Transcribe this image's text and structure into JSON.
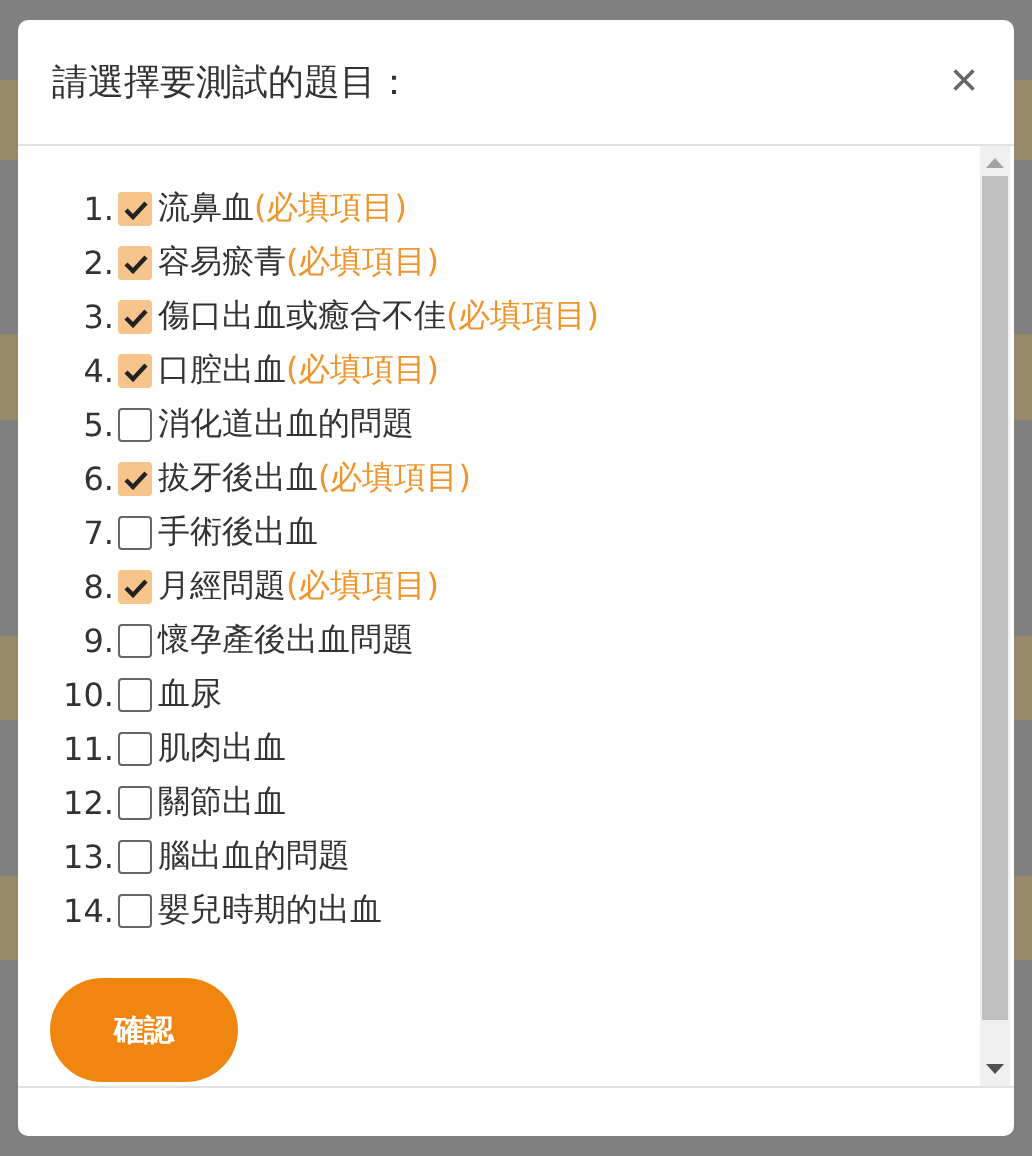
{
  "dialog": {
    "title": "請選擇要測試的題目：",
    "close": "×",
    "items": [
      {
        "number": "1.",
        "label": "流鼻血",
        "required_note": "(必填項目)",
        "checked": true
      },
      {
        "number": "2.",
        "label": "容易瘀青",
        "required_note": "(必填項目)",
        "checked": true
      },
      {
        "number": "3.",
        "label": "傷口出血或癒合不佳",
        "required_note": "(必填項目)",
        "checked": true
      },
      {
        "number": "4.",
        "label": "口腔出血",
        "required_note": "(必填項目)",
        "checked": true
      },
      {
        "number": "5.",
        "label": "消化道出血的問題",
        "checked": false
      },
      {
        "number": "6.",
        "label": "拔牙後出血",
        "required_note": "(必填項目)",
        "checked": true
      },
      {
        "number": "7.",
        "label": "手術後出血",
        "checked": false
      },
      {
        "number": "8.",
        "label": "月經問題",
        "required_note": "(必填項目)",
        "checked": true
      },
      {
        "number": "9.",
        "label": "懷孕產後出血問題",
        "checked": false
      },
      {
        "number": "10.",
        "label": "血尿",
        "checked": false
      },
      {
        "number": "11.",
        "label": "肌肉出血",
        "checked": false
      },
      {
        "number": "12.",
        "label": "關節出血",
        "checked": false
      },
      {
        "number": "13.",
        "label": "腦出血的問題",
        "checked": false
      },
      {
        "number": "14.",
        "label": "嬰兒時期的出血",
        "checked": false
      }
    ],
    "confirm_button": "確認"
  }
}
